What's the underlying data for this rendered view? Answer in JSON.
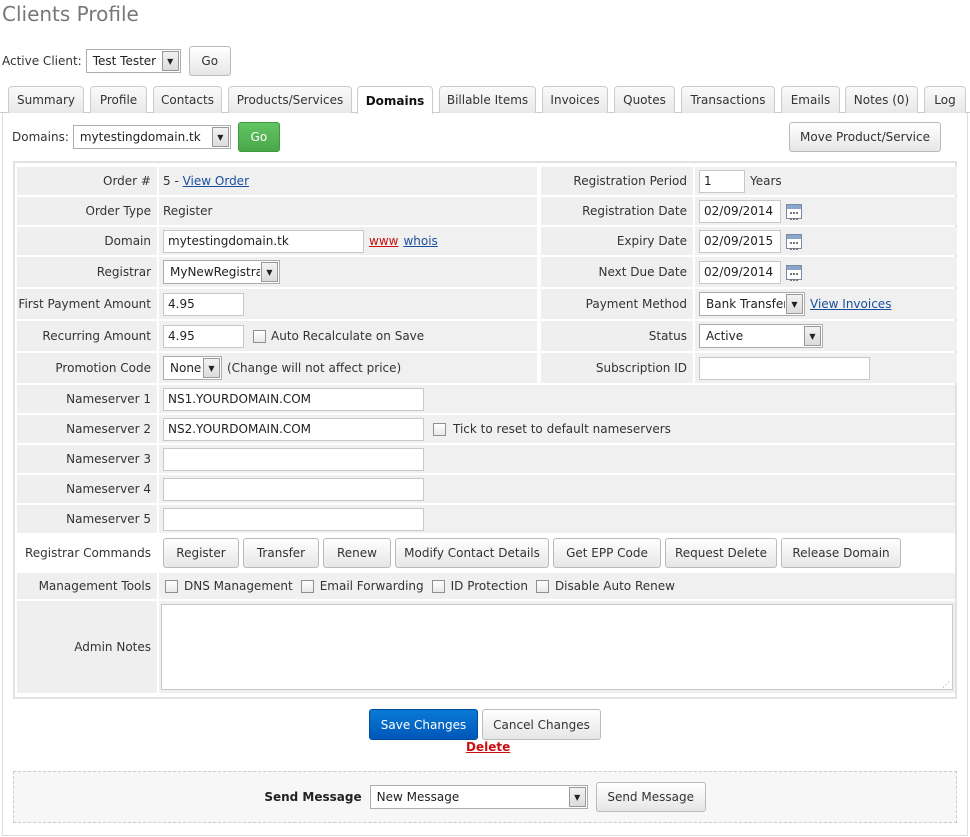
{
  "page_title": "Clients Profile",
  "active_client": {
    "label": "Active Client:",
    "value": "Test Tester",
    "go": "Go"
  },
  "tabs": [
    "Summary",
    "Profile",
    "Contacts",
    "Products/Services",
    "Domains",
    "Billable Items",
    "Invoices",
    "Quotes",
    "Transactions",
    "Emails",
    "Notes (0)",
    "Log"
  ],
  "active_tab": "Domains",
  "domains_bar": {
    "label": "Domains:",
    "value": "mytestingdomain.tk",
    "go": "Go",
    "move": "Move Product/Service"
  },
  "form": {
    "order_num_label": "Order #",
    "order_num": "5",
    "order_sep": " - ",
    "view_order": "View Order",
    "order_type_label": "Order Type",
    "order_type": "Register",
    "domain_label": "Domain",
    "domain": "mytestingdomain.tk",
    "www": "www",
    "whois": "whois",
    "registrar_label": "Registrar",
    "registrar": "MyNewRegistrar",
    "first_payment_label": "First Payment Amount",
    "first_payment": "4.95",
    "recurring_label": "Recurring Amount",
    "recurring": "4.95",
    "auto_recalc": "Auto Recalculate on Save",
    "promo_label": "Promotion Code",
    "promo": "None",
    "promo_note": "(Change will not affect price)",
    "reg_period_label": "Registration Period",
    "reg_period": "1",
    "years": "Years",
    "reg_date_label": "Registration Date",
    "reg_date": "02/09/2014",
    "expiry_label": "Expiry Date",
    "expiry": "02/09/2015",
    "next_due_label": "Next Due Date",
    "next_due": "02/09/2014",
    "payment_method_label": "Payment Method",
    "payment_method": "Bank Transfer",
    "view_invoices": "View Invoices",
    "status_label": "Status",
    "status": "Active",
    "subscription_label": "Subscription ID",
    "subscription": "",
    "ns1_label": "Nameserver 1",
    "ns1": "NS1.YOURDOMAIN.COM",
    "ns2_label": "Nameserver 2",
    "ns2": "NS2.YOURDOMAIN.COM",
    "ns_reset": "Tick to reset to default nameservers",
    "ns3_label": "Nameserver 3",
    "ns3": "",
    "ns4_label": "Nameserver 4",
    "ns4": "",
    "ns5_label": "Nameserver 5",
    "ns5": "",
    "reg_cmd_label": "Registrar Commands",
    "reg_cmds": [
      "Register",
      "Transfer",
      "Renew",
      "Modify Contact Details",
      "Get EPP Code",
      "Request Delete",
      "Release Domain"
    ],
    "mgmt_label": "Management Tools",
    "mgmt_tools": [
      "DNS Management",
      "Email Forwarding",
      "ID Protection",
      "Disable Auto Renew"
    ],
    "admin_notes_label": "Admin Notes",
    "admin_notes": ""
  },
  "actions": {
    "save": "Save Changes",
    "cancel": "Cancel Changes",
    "delete": "Delete"
  },
  "message": {
    "label": "Send Message",
    "value": "New Message",
    "button": "Send Message"
  }
}
